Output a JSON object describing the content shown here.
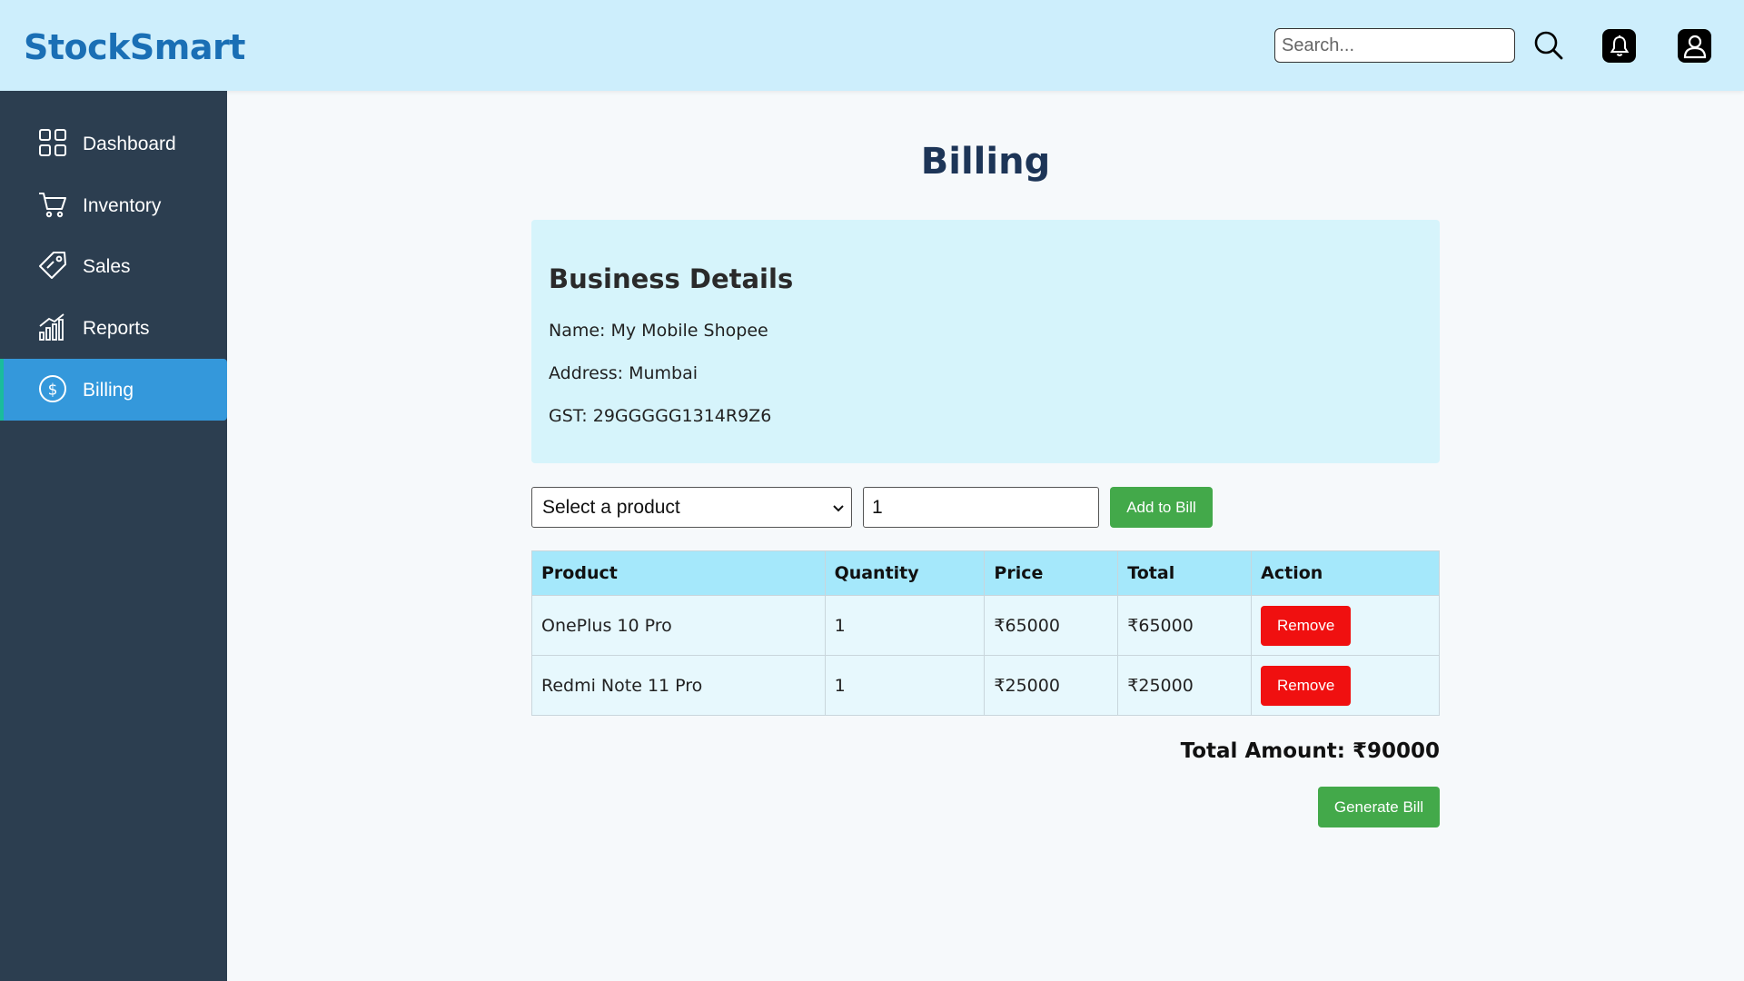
{
  "app": {
    "logo": "StockSmart"
  },
  "header": {
    "search_placeholder": "Search...",
    "icons": [
      "search-icon",
      "bell-icon",
      "user-icon"
    ]
  },
  "sidebar": {
    "items": [
      {
        "label": "Dashboard",
        "icon": "grid-icon",
        "active": false
      },
      {
        "label": "Inventory",
        "icon": "cart-icon",
        "active": false
      },
      {
        "label": "Sales",
        "icon": "tag-icon",
        "active": false
      },
      {
        "label": "Reports",
        "icon": "bar-chart-icon",
        "active": false
      },
      {
        "label": "Billing",
        "icon": "dollar-circle-icon",
        "active": true
      }
    ]
  },
  "main": {
    "title": "Billing",
    "business": {
      "heading": "Business Details",
      "name": "Name: My Mobile Shopee",
      "address": "Address: Mumbai",
      "gst": "GST: 29GGGGG1314R9Z6"
    },
    "form": {
      "product_select": "Select a product",
      "quantity": "1",
      "add_button": "Add to Bill"
    },
    "table": {
      "headers": [
        "Product",
        "Quantity",
        "Price",
        "Total",
        "Action"
      ],
      "rows": [
        {
          "product": "OnePlus 10 Pro",
          "quantity": "1",
          "price": "₹65000",
          "total": "₹65000",
          "action": "Remove"
        },
        {
          "product": "Redmi Note 11 Pro",
          "quantity": "1",
          "price": "₹25000",
          "total": "₹25000",
          "action": "Remove"
        }
      ]
    },
    "total_amount": "Total Amount: ₹90000",
    "generate_button": "Generate Bill"
  },
  "colors": {
    "header_bg": "#cdeefc",
    "sidebar_bg": "#2c3e50",
    "active_nav": "#3498db",
    "logo": "#1a6fb5",
    "green_button": "#43a94a",
    "remove_button": "#f01010"
  }
}
